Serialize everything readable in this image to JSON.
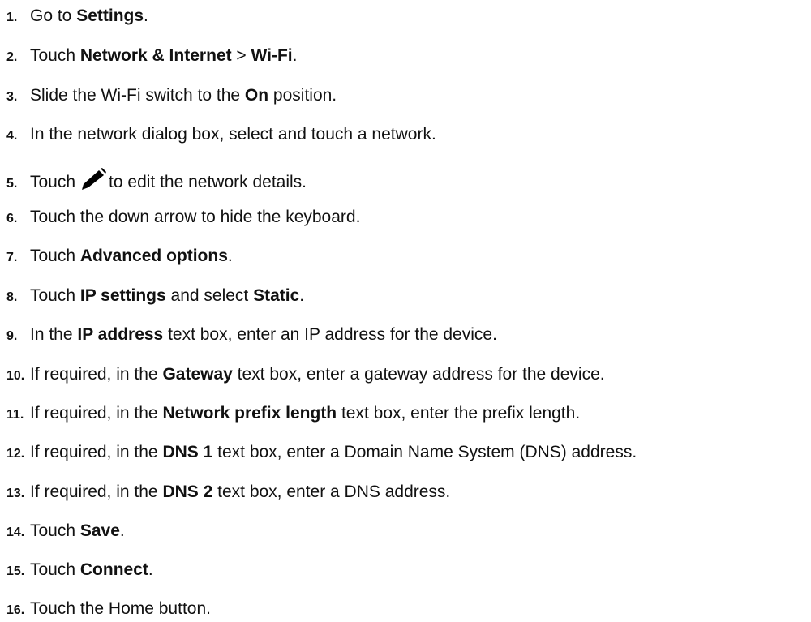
{
  "steps": [
    {
      "num": "1.",
      "t1": "Go to ",
      "b1": "Settings",
      "t2": "."
    },
    {
      "num": "2.",
      "t1": "Touch ",
      "b1": "Network & Internet",
      "t2": " > ",
      "b2": "Wi-Fi",
      "t3": "."
    },
    {
      "num": "3.",
      "t1": "Slide the Wi-Fi switch to the ",
      "b1": "On",
      "t2": " position."
    },
    {
      "num": "4.",
      "t1": "In the network dialog box, select and touch a network."
    },
    {
      "num": "5.",
      "t1": "Touch",
      "icon": "pencil-icon",
      "t2": "to edit the network details."
    },
    {
      "num": "6.",
      "t1": "Touch the down arrow to hide the keyboard."
    },
    {
      "num": "7.",
      "t1": "Touch ",
      "b1": "Advanced options",
      "t2": "."
    },
    {
      "num": "8.",
      "t1": "Touch ",
      "b1": "IP settings",
      "t2": " and select ",
      "b2": "Static",
      "t3": "."
    },
    {
      "num": "9.",
      "t1": "In the ",
      "b1": "IP address",
      "t2": " text box, enter an IP address for the device."
    },
    {
      "num": "10.",
      "t1": "If required, in the ",
      "b1": "Gateway",
      "t2": " text box, enter a gateway address for the device."
    },
    {
      "num": "11.",
      "t1": "If required, in the ",
      "b1": "Network prefix length",
      "t2": " text box, enter the prefix length."
    },
    {
      "num": "12.",
      "t1": "If required, in the ",
      "b1": "DNS 1",
      "t2": " text box, enter a Domain Name System (DNS) address."
    },
    {
      "num": "13.",
      "t1": "If required, in the ",
      "b1": "DNS 2",
      "t2": " text box, enter a DNS address."
    },
    {
      "num": "14.",
      "t1": "Touch ",
      "b1": "Save",
      "t2": "."
    },
    {
      "num": "15.",
      "t1": "Touch ",
      "b1": "Connect",
      "t2": "."
    },
    {
      "num": "16.",
      "t1": "Touch the Home button."
    }
  ]
}
